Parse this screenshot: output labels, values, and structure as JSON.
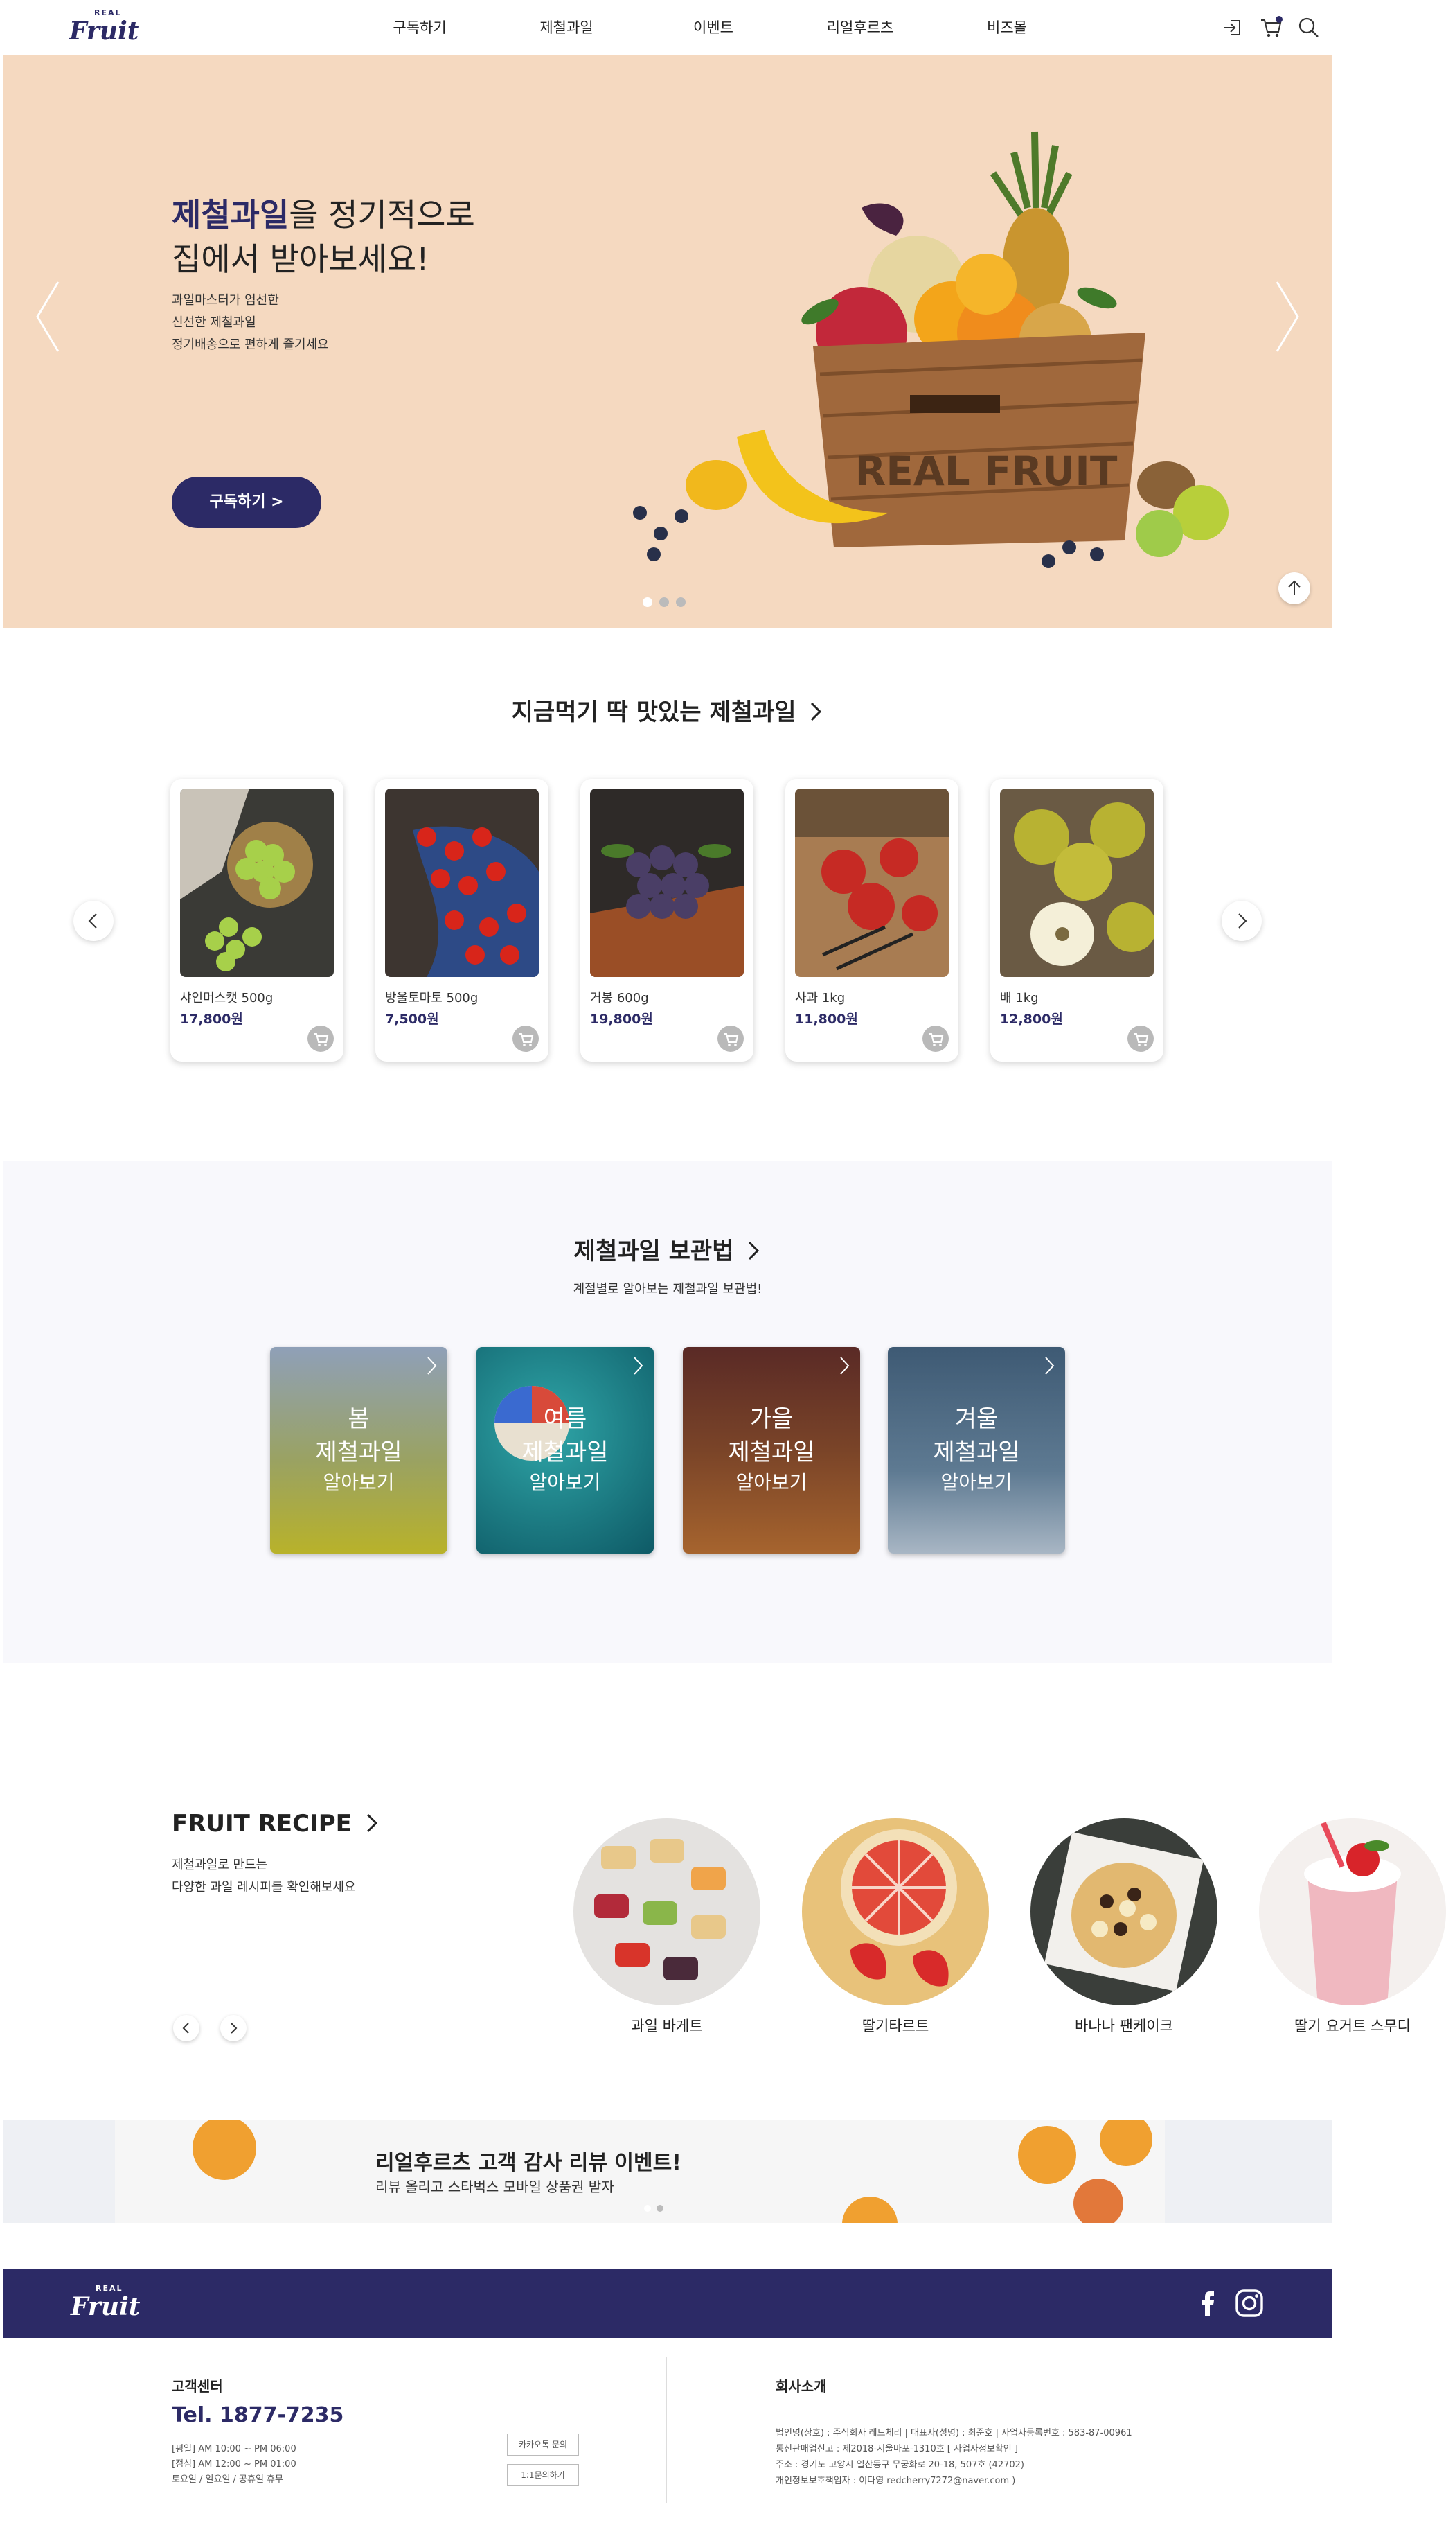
{
  "header": {
    "logo_small": "REAL",
    "logo_main": "Fruit",
    "nav": [
      "구독하기",
      "제철과일",
      "이벤트",
      "리얼후르츠",
      "비즈몰"
    ]
  },
  "hero": {
    "title_highlight": "제철과일",
    "title_rest_1": "을 정기적으로",
    "title_line_2": "집에서 받아보세요!",
    "desc": [
      "과일마스터가 엄선한",
      "신선한 제철과일",
      "정기배송으로 편하게 즐기세요"
    ],
    "button": "구독하기 >",
    "basket_text": "REAL FRUIT"
  },
  "products_section": {
    "title": "지금먹기 딱 맛있는 제철과일",
    "items": [
      {
        "name": "샤인머스캣 500g",
        "price": "17,800원"
      },
      {
        "name": "방울토마토 500g",
        "price": "7,500원"
      },
      {
        "name": "거봉 600g",
        "price": "19,800원"
      },
      {
        "name": "사과 1kg",
        "price": "11,800원"
      },
      {
        "name": "배 1kg",
        "price": "12,800원"
      }
    ]
  },
  "storage_section": {
    "title": "제철과일 보관법",
    "subtitle": "계절별로 알아보는 제철과일 보관법!",
    "seasons": [
      {
        "season": "봄",
        "line2": "제철과일",
        "line3": "알아보기"
      },
      {
        "season": "여름",
        "line2": "제철과일",
        "line3": "알아보기"
      },
      {
        "season": "가을",
        "line2": "제철과일",
        "line3": "알아보기"
      },
      {
        "season": "겨울",
        "line2": "제철과일",
        "line3": "알아보기"
      }
    ]
  },
  "recipe_section": {
    "title": "FRUIT RECIPE",
    "desc": [
      "제철과일로 만드는",
      "다양한 과일 레시피를 확인해보세요"
    ],
    "items": [
      {
        "name": "과일 바게트"
      },
      {
        "name": "딸기타르트"
      },
      {
        "name": "바나나 팬케이크"
      },
      {
        "name": "딸기 요거트 스무디"
      }
    ]
  },
  "banner": {
    "title": "리얼후르츠 고객 감사 리뷰 이벤트!",
    "subtitle": "리뷰 올리고 스타벅스 모바일 상품권 받자"
  },
  "footer": {
    "cs_title": "고객센터",
    "tel": "Tel. 1877-7235",
    "hours": [
      "[평일] AM 10:00 ~ PM 06:00",
      "[점심] AM 12:00 ~ PM 01:00",
      "토요일 / 일요일 / 공휴일 휴무"
    ],
    "kakao_button": "카카오톡 문의",
    "inquiry_button": "1:1문의하기",
    "company_title": "회사소개",
    "company_info": [
      "법인명(상호) : 주식회사 레드체리 | 대표자(성명) : 최준호 | 사업자등록번호 : 583-87-00961",
      "통신판매업신고 : 제2018-서울마포-1310호 [ 사업자정보확인 ]",
      "주소 : 경기도 고양시 일산동구 무궁화로 20-18, 507호 (42702)",
      "개인정보보호책임자 : 이다영 redcherry7272@naver.com )"
    ]
  },
  "colors": {
    "brand": "#2c2a66",
    "hero_bg": "#f5d9c0",
    "price": "#2c2a66"
  }
}
